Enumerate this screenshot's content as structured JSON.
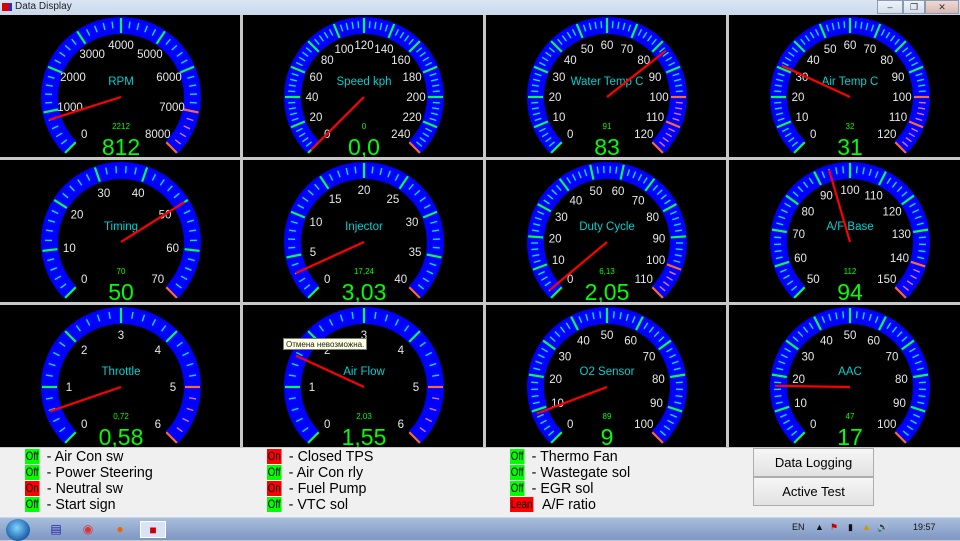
{
  "window": {
    "title": "Data Display",
    "controls": [
      "minimize",
      "restore",
      "close"
    ]
  },
  "colors": {
    "gauge_arc": "#0000ff",
    "tick_major": "#00ff44",
    "tick_minor": "#00e5e5",
    "tick_red": "#ff6a2a",
    "needle": "#ff0000",
    "title": "#00d0d0",
    "value": "#00ff00",
    "on": "#ff0000",
    "off": "#00ff00"
  },
  "gauges": [
    {
      "title": "RPM",
      "min": 0,
      "max": 8000,
      "labels": [
        "0",
        "1000",
        "2000",
        "3000",
        "4000",
        "5000",
        "6000",
        "7000",
        "8000"
      ],
      "redline": 7000,
      "value": "812",
      "needle": 812,
      "secondary": "2212"
    },
    {
      "title": "Speed kph",
      "min": 0,
      "max": 240,
      "labels": [
        "0",
        "20",
        "40",
        "60",
        "80",
        "100",
        "120",
        "140",
        "160",
        "180",
        "200",
        "220",
        "240"
      ],
      "redline": 240,
      "value": "0,0",
      "needle": 0,
      "secondary": "0"
    },
    {
      "title": "Water Temp C",
      "min": 0,
      "max": 120,
      "labels": [
        "0",
        "10",
        "20",
        "30",
        "40",
        "50",
        "60",
        "70",
        "80",
        "90",
        "100",
        "110",
        "120"
      ],
      "redline": 100,
      "value": "83",
      "needle": 83,
      "secondary": "91"
    },
    {
      "title": "Air Temp C",
      "min": 0,
      "max": 120,
      "labels": [
        "0",
        "10",
        "20",
        "30",
        "40",
        "50",
        "60",
        "70",
        "80",
        "90",
        "100",
        "110",
        "120"
      ],
      "redline": 100,
      "value": "31",
      "needle": 31,
      "secondary": "32"
    },
    {
      "title": "Timing",
      "min": 0,
      "max": 70,
      "labels": [
        "0",
        "10",
        "20",
        "30",
        "40",
        "50",
        "60",
        "70"
      ],
      "redline": 70,
      "value": "50",
      "needle": 50,
      "secondary": "70"
    },
    {
      "title": "Injector",
      "min": 0,
      "max": 40,
      "labels": [
        "0",
        "5",
        "10",
        "15",
        "20",
        "25",
        "30",
        "35",
        "40"
      ],
      "redline": 40,
      "value": "3,03",
      "needle": 3.03,
      "secondary": "17,24"
    },
    {
      "title": "Duty Cycle",
      "min": 0,
      "max": 110,
      "labels": [
        "0",
        "10",
        "20",
        "30",
        "40",
        "50",
        "60",
        "70",
        "80",
        "90",
        "100",
        "110"
      ],
      "redline": 100,
      "value": "2,05",
      "needle": 2.05,
      "secondary": "6,13"
    },
    {
      "title": "A/F Base",
      "min": 50,
      "max": 150,
      "labels": [
        "50",
        "60",
        "70",
        "80",
        "90",
        "100",
        "110",
        "120",
        "130",
        "140",
        "150"
      ],
      "redline": 140,
      "value": "94",
      "needle": 94,
      "secondary": "112"
    },
    {
      "title": "Throttle",
      "min": 0,
      "max": 6,
      "labels": [
        "0",
        "1",
        "2",
        "3",
        "4",
        "5",
        "6"
      ],
      "redline": 5,
      "value": "0,58",
      "needle": 0.58,
      "secondary": "0,72"
    },
    {
      "title": "Air Flow",
      "min": 0,
      "max": 6,
      "labels": [
        "0",
        "1",
        "2",
        "3",
        "4",
        "5",
        "6"
      ],
      "redline": 5,
      "value": "1,55",
      "needle": 1.55,
      "secondary": "2,03"
    },
    {
      "title": "O2 Sensor",
      "min": 0,
      "max": 100,
      "labels": [
        "0",
        "10",
        "20",
        "30",
        "40",
        "50",
        "60",
        "70",
        "80",
        "90",
        "100"
      ],
      "redline": 100,
      "value": "9",
      "needle": 9,
      "secondary": "89"
    },
    {
      "title": "AAC",
      "min": 0,
      "max": 100,
      "labels": [
        "0",
        "10",
        "20",
        "30",
        "40",
        "50",
        "60",
        "70",
        "80",
        "90",
        "100"
      ],
      "redline": 100,
      "value": "17",
      "needle": 17,
      "secondary": "47"
    }
  ],
  "tooltip": "Отмена невозможна.",
  "status": [
    {
      "state": "Off",
      "label": "- Air Con sw"
    },
    {
      "state": "Off",
      "label": "- Power Steering"
    },
    {
      "state": "On",
      "label": "- Neutral sw"
    },
    {
      "state": "Off",
      "label": "- Start sign"
    },
    {
      "state": "On",
      "label": "- Closed TPS"
    },
    {
      "state": "Off",
      "label": "- Air Con rly"
    },
    {
      "state": "On",
      "label": "- Fuel Pump"
    },
    {
      "state": "Off",
      "label": "- VTC sol"
    },
    {
      "state": "Off",
      "label": "- Thermo Fan"
    },
    {
      "state": "Off",
      "label": "- Wastegate sol"
    },
    {
      "state": "Off",
      "label": "- EGR sol"
    },
    {
      "state": "Lean",
      "label": "A/F ratio"
    }
  ],
  "buttons": {
    "data_logging": "Data Logging",
    "active_test": "Active Test"
  },
  "taskbar": {
    "language": "EN",
    "clock": "19:57",
    "apps": [
      "floppy-app",
      "chrome",
      "firefox",
      "data-display-app"
    ]
  }
}
